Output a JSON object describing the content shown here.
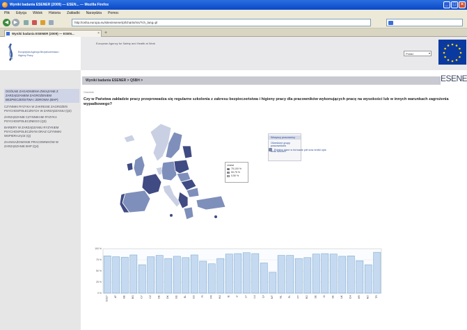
{
  "window": {
    "title": "Wyniki badania ESENER (2009) — ESEN... — Mozilla Firefox",
    "controls": [
      "_",
      "□",
      "×"
    ]
  },
  "menubar": {
    "items": [
      "Plik",
      "Edycja",
      "Widok",
      "Historia",
      "Zakładki",
      "Narzędzia",
      "Pomoc"
    ]
  },
  "navbar": {
    "url": "http://osha.europa.eu/sites/esener/pl/charts/ms/?ch_lang=pl"
  },
  "tabs": [
    {
      "label": "Wyniki badania ESENER (2009) — ESEN..."
    }
  ],
  "header": {
    "agency_name": "Europejska Agencja Bezpieczeństwa i Higieny Pracy",
    "slogan": "European Agency for Safety and Health at Work",
    "language": "Polski",
    "brand_logo": "ESENER"
  },
  "sidebar": {
    "items": [
      {
        "label": "OGÓLNE ZAGADNIENIA ZWIĄZANE Z ZARZĄDZANIEM ZAGROŻENIEM BEZPIECZEŃSTWA I ZDROWIA (BHP)",
        "active": true
      },
      {
        "label": "CZYNNIKI RYZYKA W ZAKRESIE ZAGROŻEŃ PSYCHOSPOŁECZNYCH W ZARZĄDZANIU (Q2)",
        "active": false
      },
      {
        "label": "ZARZĄDZANIE CZYNNIKAMI RYZYKA PSYCHOSPOŁECZNEGO (Q3)",
        "active": false
      },
      {
        "label": "BARIERY W ZARZĄDZANIU RYZYKIEM PSYCHOSPOŁECZNYM ORAZ CZYNNIKI WSPIERAJĄCE (Q)",
        "active": false
      },
      {
        "label": "ZAANGAŻOWANIE PRACOWNIKÓW W ZARZĄDZANIE BHP (Q4)",
        "active": false
      }
    ]
  },
  "main": {
    "breadcrumb": "Wyniki badania ESENER > Q5BH >",
    "small_link": "Ocenekłe",
    "question": "Czy w Państwa zakładzie pracy przeprowadza się regularne szkolenia z zakresu bezpieczeństwa i higieny pracy dla pracowników wykonujących pracę na wysokości lub w innych warunkach zagrożenia wypadkowego?",
    "options": [
      "Wszyscy pracownicy",
      "Określone grupy pracowników",
      "Brak szkoleń"
    ],
    "pdf_link": "Pobierz dane w formacie pdf oraz krótki opis"
  },
  "map_legend": {
    "title": "Udział",
    "items": [
      {
        "label": "75-100 %",
        "color": "#3f4b82"
      },
      {
        "label": "50-75 %",
        "color": "#7f8fbb"
      },
      {
        "label": "0-50 %",
        "color": "#c9d0e3"
      }
    ]
  },
  "chart_data": {
    "type": "bar",
    "categories": [
      "EU27",
      "AT",
      "BE",
      "BG",
      "CY",
      "CZ",
      "DE",
      "DK",
      "EE",
      "EL",
      "ES",
      "FI",
      "FR",
      "HU",
      "IE",
      "IT",
      "LT",
      "LU",
      "LV",
      "MT",
      "NL",
      "PL",
      "PT",
      "RO",
      "SE",
      "SI",
      "SK",
      "UK",
      "CH",
      "HR",
      "NO",
      "TR"
    ],
    "values": [
      84,
      82,
      81,
      86,
      64,
      82,
      85,
      78,
      83,
      80,
      86,
      72,
      66,
      78,
      88,
      89,
      91,
      89,
      68,
      47,
      85,
      85,
      78,
      80,
      88,
      89,
      88,
      83,
      84,
      73,
      64,
      92
    ],
    "ylim": [
      0,
      100
    ],
    "grid": true,
    "bar_color": "#c5daf0",
    "bar_edge": "#6e9fc7"
  }
}
